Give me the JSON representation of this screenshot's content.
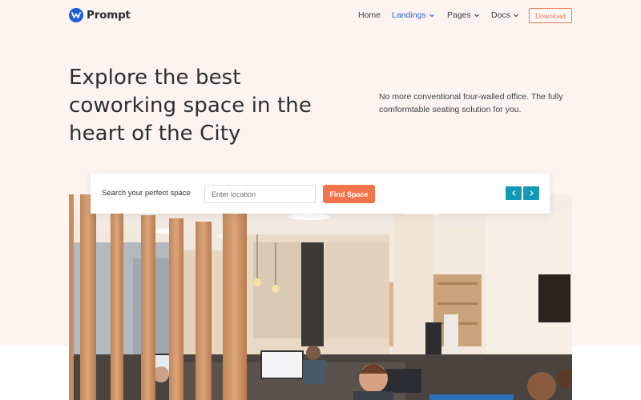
{
  "brand": {
    "name": "Prompt",
    "logo_icon": "w-logo-icon",
    "logo_color": "#1a5fd6"
  },
  "nav": {
    "items": [
      {
        "label": "Home",
        "has_dropdown": false,
        "active": false
      },
      {
        "label": "Landings",
        "has_dropdown": true,
        "active": true
      },
      {
        "label": "Pages",
        "has_dropdown": true,
        "active": false
      },
      {
        "label": "Docs",
        "has_dropdown": true,
        "active": false
      }
    ],
    "download_label": "Download"
  },
  "hero": {
    "title": "Explore the best coworking space in the heart of the City",
    "subtitle": "No more conventional four-walled office. The fully comformtable seating solution for you."
  },
  "search": {
    "label": "Search your perfect space",
    "placeholder": "Enter location",
    "value": "",
    "button_label": "Find Space",
    "prev_icon": "chevron-left-icon",
    "next_icon": "chevron-right-icon"
  },
  "colors": {
    "hero_bg": "#fdf4f1",
    "accent": "#f3734b",
    "link_active": "#2563d9",
    "arrow_bg": "#129ab5"
  }
}
